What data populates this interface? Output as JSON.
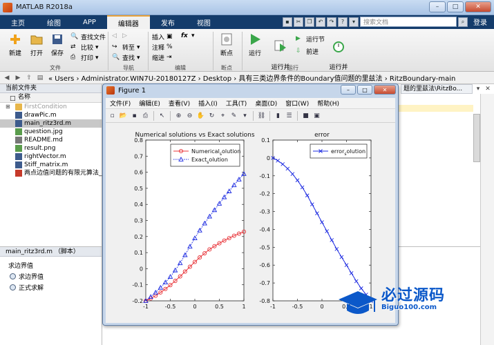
{
  "window": {
    "title": "MATLAB R2018a"
  },
  "tabs": [
    "主页",
    "绘图",
    "APP",
    "编辑器",
    "发布",
    "视图"
  ],
  "active_tab": "编辑器",
  "search": {
    "placeholder": "搜索文档"
  },
  "login_label": "登录",
  "ribbon": {
    "file": {
      "new": "新建",
      "open": "打开",
      "save": "保存",
      "find_files": "查找文件",
      "compare": "比较",
      "print": "打印",
      "label": "文件"
    },
    "navigate": {
      "goto": "转至",
      "find": "查找",
      "label": "导航"
    },
    "edit": {
      "insert": "插入",
      "comment": "注释",
      "indent": "缩进",
      "label": "编辑"
    },
    "breakpoints": {
      "breakpoints": "断点",
      "label": "断点"
    },
    "run": {
      "run": "运行",
      "run_advance": "运行并\n前进",
      "run_section": "运行节",
      "advance": "前进",
      "run_time": "运行并\n计时",
      "label": "运行"
    }
  },
  "address": {
    "path": "« Users › Administrator.WIN7U-20180127Z › Desktop › 具有三类边界条件的Boundary值问题的里兹法 › RitzBoundary-main"
  },
  "current_folder": {
    "title": "当前文件夹",
    "column": "名称",
    "files": [
      {
        "name": "FirstCondition",
        "type": "folder"
      },
      {
        "name": "drawPic.m",
        "type": "m"
      },
      {
        "name": "main_ritz3rd.m",
        "type": "m",
        "selected": true
      },
      {
        "name": "question.jpg",
        "type": "img"
      },
      {
        "name": "README.md",
        "type": "md"
      },
      {
        "name": "result.png",
        "type": "img"
      },
      {
        "name": "rightVector.m",
        "type": "m"
      },
      {
        "name": "Stiff_matrix.m",
        "type": "m"
      },
      {
        "name": "两点边值问题的有限元算法_",
        "type": "pdf"
      }
    ]
  },
  "details": {
    "header": "main_ritz3rd.m （脚本）",
    "line": "求边界值",
    "items": [
      "求边界值",
      "正式求解"
    ]
  },
  "editor": {
    "tab_label": "题的里兹法\\RitzBo..."
  },
  "figure": {
    "title": "Figure 1",
    "menu": [
      "文件(F)",
      "编辑(E)",
      "查看(V)",
      "插入(I)",
      "工具(T)",
      "桌面(D)",
      "窗口(W)",
      "帮助(H)"
    ]
  },
  "watermark": {
    "text": "必过源码",
    "sub": "Biguo100.com"
  },
  "colors": {
    "numerical": "#e8353a",
    "exact": "#1a28e0",
    "error": "#1a28e0",
    "accent": "#e9a23b"
  },
  "chart_data": [
    {
      "type": "line",
      "title": "Numerical solutions vs Exact solutions",
      "xlim": [
        -1,
        1
      ],
      "ylim": [
        -0.2,
        0.8
      ],
      "xticks": [
        -1,
        -0.5,
        0,
        0.5,
        1
      ],
      "yticks": [
        -0.2,
        -0.1,
        0,
        0.1,
        0.2,
        0.3,
        0.4,
        0.5,
        0.6,
        0.7,
        0.8
      ],
      "xtick_labels": [
        "-1",
        "-0.5",
        "0",
        "0.5",
        "1"
      ],
      "ytick_labels": [
        "-0.2",
        "-0.1",
        "0",
        "0.1",
        "0.2",
        "0.3",
        "0.4",
        "0.5",
        "0.6",
        "0.7",
        "0.8"
      ],
      "legend": {
        "position": "top-right",
        "labels": [
          "Numerical_solution",
          "Exact_solution"
        ]
      },
      "series": [
        {
          "name": "Numerical_solution",
          "color": "#e8353a",
          "marker": "circle",
          "line": "solid",
          "x": [
            -1,
            -0.9,
            -0.8,
            -0.7,
            -0.6,
            -0.5,
            -0.4,
            -0.3,
            -0.2,
            -0.1,
            0,
            0.1,
            0.2,
            0.3,
            0.4,
            0.5,
            0.6,
            0.7,
            0.8,
            0.9,
            1
          ],
          "y": [
            -0.2,
            -0.185,
            -0.168,
            -0.148,
            -0.126,
            -0.102,
            -0.076,
            -0.048,
            -0.018,
            0.012,
            0.042,
            0.07,
            0.096,
            0.12,
            0.14,
            0.158,
            0.175,
            0.19,
            0.205,
            0.218,
            0.23
          ]
        },
        {
          "name": "Exact_solution",
          "color": "#1a28e0",
          "marker": "triangle",
          "line": "dotted",
          "x": [
            -1,
            -0.9,
            -0.8,
            -0.7,
            -0.6,
            -0.5,
            -0.4,
            -0.3,
            -0.2,
            -0.1,
            0,
            0.1,
            0.2,
            0.3,
            0.4,
            0.5,
            0.6,
            0.7,
            0.8,
            0.9,
            1
          ],
          "y": [
            -0.2,
            -0.175,
            -0.148,
            -0.118,
            -0.085,
            -0.05,
            -0.01,
            0.035,
            0.085,
            0.138,
            0.19,
            0.238,
            0.282,
            0.325,
            0.365,
            0.405,
            0.445,
            0.482,
            0.52,
            0.555,
            0.59
          ]
        }
      ]
    },
    {
      "type": "line",
      "title": "error",
      "xlim": [
        -1,
        1
      ],
      "ylim": [
        -0.8,
        0.1
      ],
      "xticks": [
        -1,
        -0.5,
        0,
        0.5,
        1
      ],
      "yticks": [
        -0.8,
        -0.7,
        -0.6,
        -0.5,
        -0.4,
        -0.3,
        -0.2,
        -0.1,
        0,
        0.1
      ],
      "xtick_labels": [
        "-1",
        "-0.5",
        "0",
        "0.5",
        "1"
      ],
      "ytick_labels": [
        "-0.8",
        "-0.7",
        "-0.6",
        "-0.5",
        "-0.4",
        "-0.3",
        "-0.2",
        "-0.1",
        "0",
        "0.1"
      ],
      "legend": {
        "position": "top-right",
        "labels": [
          "error_solution"
        ]
      },
      "series": [
        {
          "name": "error_solution",
          "color": "#1a28e0",
          "marker": "x",
          "line": "solid",
          "x": [
            -1,
            -0.9,
            -0.8,
            -0.7,
            -0.6,
            -0.5,
            -0.4,
            -0.3,
            -0.2,
            -0.1,
            0,
            0.1,
            0.2,
            0.3,
            0.4,
            0.5,
            0.6,
            0.7,
            0.8,
            0.9,
            1
          ],
          "y": [
            0.0,
            -0.015,
            -0.035,
            -0.06,
            -0.09,
            -0.125,
            -0.165,
            -0.21,
            -0.26,
            -0.31,
            -0.36,
            -0.41,
            -0.46,
            -0.51,
            -0.555,
            -0.6,
            -0.645,
            -0.69,
            -0.73,
            -0.765,
            -0.8
          ]
        }
      ]
    }
  ]
}
